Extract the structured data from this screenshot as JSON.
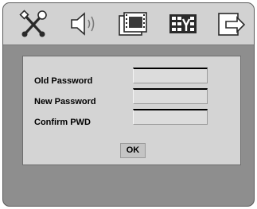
{
  "topbar": {
    "tabs": [
      {
        "icon": "tools-icon"
      },
      {
        "icon": "speaker-icon"
      },
      {
        "icon": "film-icon"
      },
      {
        "icon": "parental-control-icon"
      },
      {
        "icon": "exit-icon"
      }
    ]
  },
  "dialog": {
    "old_password_label": "Old Password",
    "new_password_label": "New Password",
    "confirm_label": "Confirm PWD",
    "old_password_value": "",
    "new_password_value": "",
    "confirm_value": "",
    "ok_label": "OK"
  }
}
